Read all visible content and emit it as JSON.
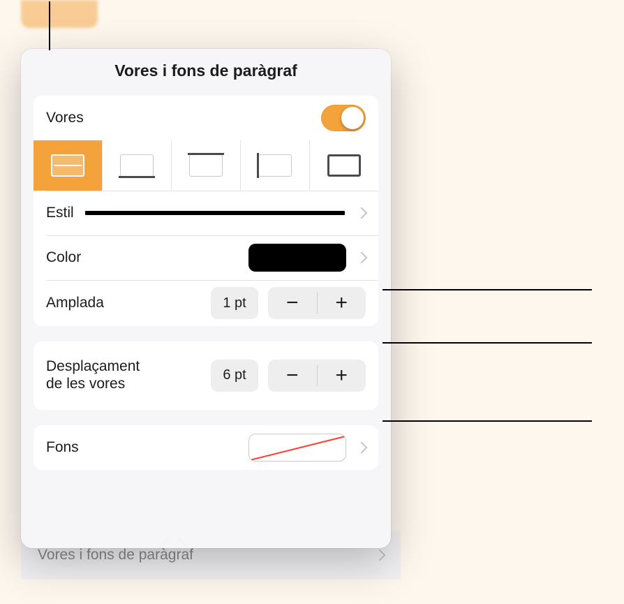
{
  "popover": {
    "title": "Vores i fons de paràgraf",
    "borders_row": {
      "label": "Vores",
      "enabled": true
    },
    "border_side": "all-with-mid",
    "style_row": {
      "label": "Estil"
    },
    "color_row": {
      "label": "Color",
      "swatch": "#000000"
    },
    "width_row": {
      "label": "Amplada",
      "value": "1 pt"
    },
    "offset_row": {
      "label": "Desplaçament\nde les vores",
      "value": "6 pt"
    },
    "fill_row": {
      "label": "Fons"
    }
  },
  "underlying_row": {
    "label": "Vores i fons de paràgraf"
  }
}
